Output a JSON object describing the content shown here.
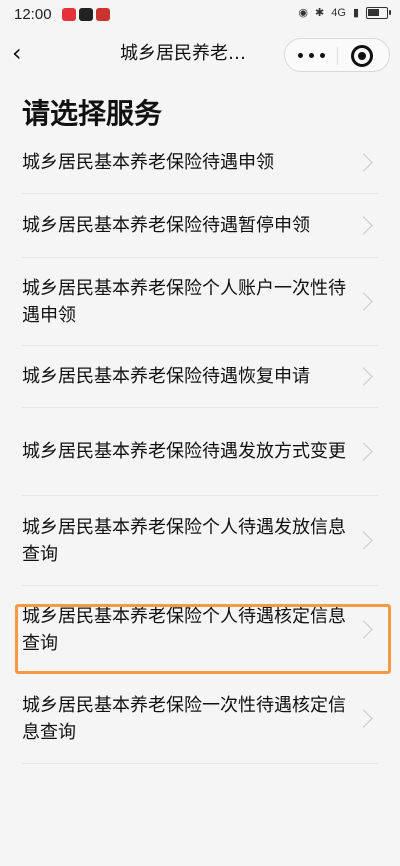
{
  "status_bar": {
    "time": "12:00",
    "signal": "4G"
  },
  "navbar": {
    "title": "城乡居民养老…"
  },
  "page": {
    "heading": "请选择服务"
  },
  "services": [
    {
      "label": "城乡居民基本养老保险待遇申领"
    },
    {
      "label": "城乡居民基本养老保险待遇暂停申领"
    },
    {
      "label": "城乡居民基本养老保险个人账户一次性待遇申领"
    },
    {
      "label": "城乡居民基本养老保险待遇恢复申请"
    },
    {
      "label": "城乡居民基本养老保险待遇发放方式变更"
    },
    {
      "label": "城乡居民基本养老保险个人待遇发放信息查询"
    },
    {
      "label": "城乡居民基本养老保险个人待遇核定信息查询"
    },
    {
      "label": "城乡居民基本养老保险一次性待遇核定信息查询"
    }
  ],
  "colors": {
    "highlight": "#f39a42"
  }
}
